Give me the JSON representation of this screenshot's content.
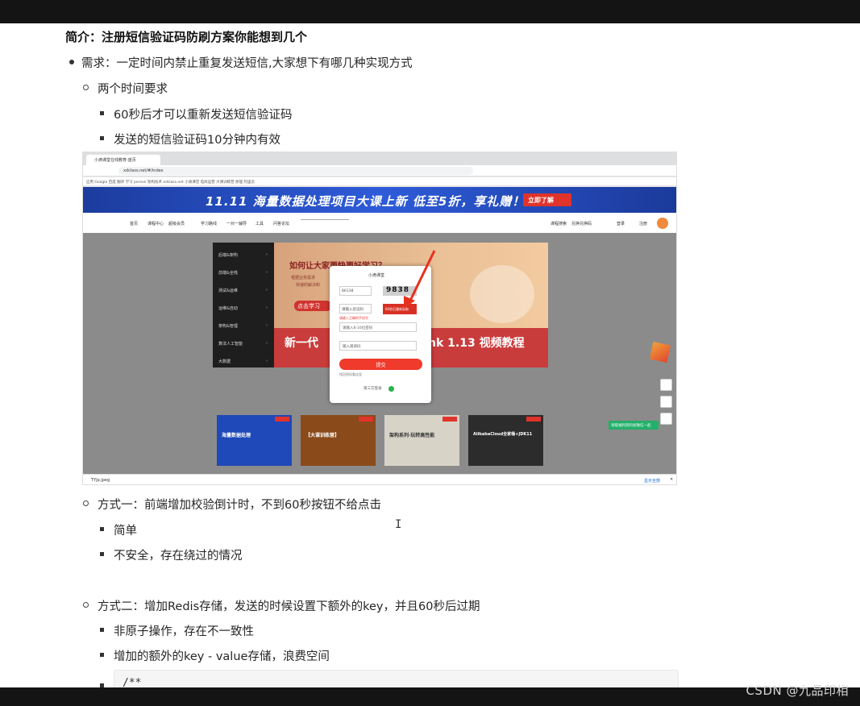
{
  "doc": {
    "title": "简介：注册短信验证码防刷方案你能想到几个",
    "requirement": "需求：一定时间内禁止重复发送短信,大家想下有哪几种实现方式",
    "time_req_title": "两个时间要求",
    "time_req_1": "60秒后才可以重新发送短信验证码",
    "time_req_2": "发送的短信验证码10分钟内有效",
    "method1_title": "方式一：前端增加校验倒计时，不到60秒按钮不给点击",
    "method1_pro": "简单",
    "method1_con": "不安全，存在绕过的情况",
    "method2_title": "方式二：增加Redis存储，发送的时候设置下额外的key，并且60秒后过期",
    "method2_con1": "非原子操作，存在不一致性",
    "method2_con2": "增加的额外的key - value存储，浪费空间",
    "code_line": "/**"
  },
  "watermark": "CSDN @九品印相",
  "screenshot": {
    "tab_title": "小滴课堂在线教育-首页",
    "url": "xdclass.net/#/index",
    "bookmarks": "应用  Google  百度  翻译  学习  person  架构技术  xdclass.net  小滴课堂  电商运营  大课训练营  原理  阿里云",
    "banner_text": "11.11 海量数据处理项目大课上新  低至5折，享礼赠！",
    "banner_button": "立即了解",
    "nav": [
      "首页",
      "课程中心",
      "超级会员",
      "学习路线",
      "一对一辅导",
      "工具",
      "问答论坛"
    ],
    "nav_right": [
      "课程搜索",
      "兑换兑换码",
      "登录",
      "注册"
    ],
    "side_menu": [
      "后端&架构",
      "前端&全栈",
      "测试&运维",
      "运维&自动",
      "架构&管理",
      "算法人工智能",
      "大数据"
    ],
    "hero_question": "如何让大家更快更好学习？",
    "hero_sub1": "根据业务需求",
    "hero_sub2": "快速的解决和",
    "hero_button": "点击学习",
    "hero_big_left": "新一代",
    "hero_big_right": "nk 1.13 视频教程",
    "modal": {
      "logo": "小滴课堂",
      "phone_placeholder": "86138",
      "captcha": "9838",
      "sms_code_placeholder": "请输入验证码",
      "sms_button": "60秒后重新获取",
      "error": "请输入正确的手机号",
      "password_placeholder": "请输入8-16位密码",
      "invite_placeholder": "输入邀请码",
      "submit": "提交",
      "forgot": "找回密码看这里",
      "third_party": "第三方登录"
    },
    "cards": [
      {
        "label": "海量数据处理"
      },
      {
        "label": "【大课训练营】"
      },
      {
        "label": "架构系列·玩转高性能"
      },
      {
        "label": "AlibabaCloud全家桶+JDK11"
      }
    ],
    "green_pill": "领取福利资料加微信一起",
    "download_name": "TYJp.jpeg",
    "download_show_all": "显示全部"
  }
}
